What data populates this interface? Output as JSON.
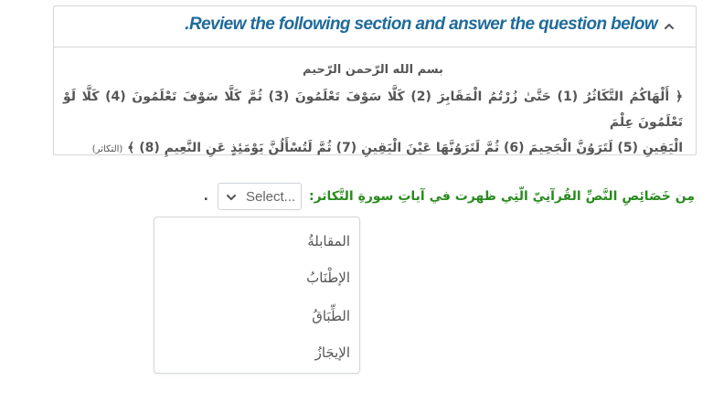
{
  "panel": {
    "title": ".Review the following section and answer the question below",
    "collapse_icon": "chevron-up-icon",
    "basmala": "بسم الله الرّحمن الرّحيم",
    "verses_line1": "﴿ أَلْهَاكُمُ التَّكَاثُرُ (1) حَتَّىٰ زُرْتُمُ الْمَقَابِرَ (2) كَلَّا سَوْفَ تَعْلَمُونَ (3) ثُمَّ كَلَّا سَوْفَ تَعْلَمُونَ (4) كَلَّا لَوْ تَعْلَمُونَ عِلْمَ",
    "verses_line2": "الْيَقِينِ (5) لَتَرَوُنَّ الْجَحِيمَ (6) ثُمَّ لَتَرَوُنَّهَا عَيْنَ الْيَقِينِ (7) ثُمَّ لَتُسْأَلُنَّ يَوْمَئِذٍ عَنِ النَّعِيمِ (8) ﴾",
    "verse_source": "(التكاثر)"
  },
  "question": {
    "text": "مِن خَصَائِصِ النَّصِّ القُرآنِيّ الّتِي ظهرت في آياتِ سورةِ التَّكاثر:",
    "trailing": ".",
    "select": {
      "label": "Select...",
      "icon": "chevron-down-icon"
    }
  },
  "dropdown": {
    "options": [
      "المقابلةُ",
      "الإطْنَابُ",
      "الطِّبَاقُ",
      "الإيجَازُ"
    ]
  }
}
